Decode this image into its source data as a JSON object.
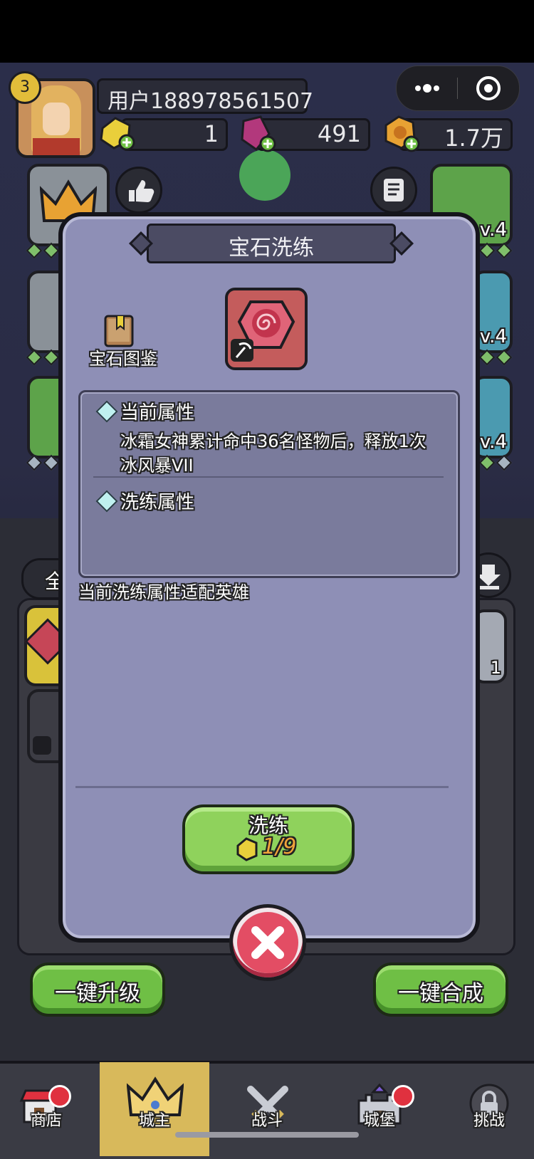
{
  "user": {
    "level": "3",
    "name": "用户188978561507"
  },
  "currencies": [
    {
      "name": "gold-ore",
      "value": "1",
      "color": "#e9cf3b"
    },
    {
      "name": "gem",
      "value": "491",
      "color": "#b2387c"
    },
    {
      "name": "coin",
      "value": "1.7万",
      "color": "#e8a233"
    }
  ],
  "side_levels": [
    "v.4",
    "v.4",
    "v.4"
  ],
  "dialog": {
    "title": "宝石洗练",
    "codex_label": "宝石图鉴",
    "current_attr_label": "当前属性",
    "current_attr_text": "冰霜女神累计命中36名怪物后，释放1次冰风暴VII",
    "refine_attr_label": "洗练属性",
    "hint": "当前洗练属性适配英雄",
    "refine_button": {
      "label": "洗练",
      "cost": "1/9"
    }
  },
  "inventory": {
    "filter_tab": "全",
    "count": "1"
  },
  "actions": {
    "upgrade_all": "一键升级",
    "merge_all": "一键合成"
  },
  "nav": [
    {
      "label": "商店",
      "icon": "shop-icon",
      "badge": true,
      "active": false
    },
    {
      "label": "城主",
      "icon": "crown-icon",
      "badge": false,
      "active": true
    },
    {
      "label": "战斗",
      "icon": "swords-icon",
      "badge": false,
      "active": false
    },
    {
      "label": "城堡",
      "icon": "castle-icon",
      "badge": true,
      "active": false
    },
    {
      "label": "挑战",
      "icon": "lock-icon",
      "badge": false,
      "active": false
    }
  ],
  "colors": {
    "dialog_bg": "#8e8fb6",
    "refine_button": "#8fd25c",
    "close_button": "#e34d64",
    "nav_active": "#d8b95b"
  }
}
